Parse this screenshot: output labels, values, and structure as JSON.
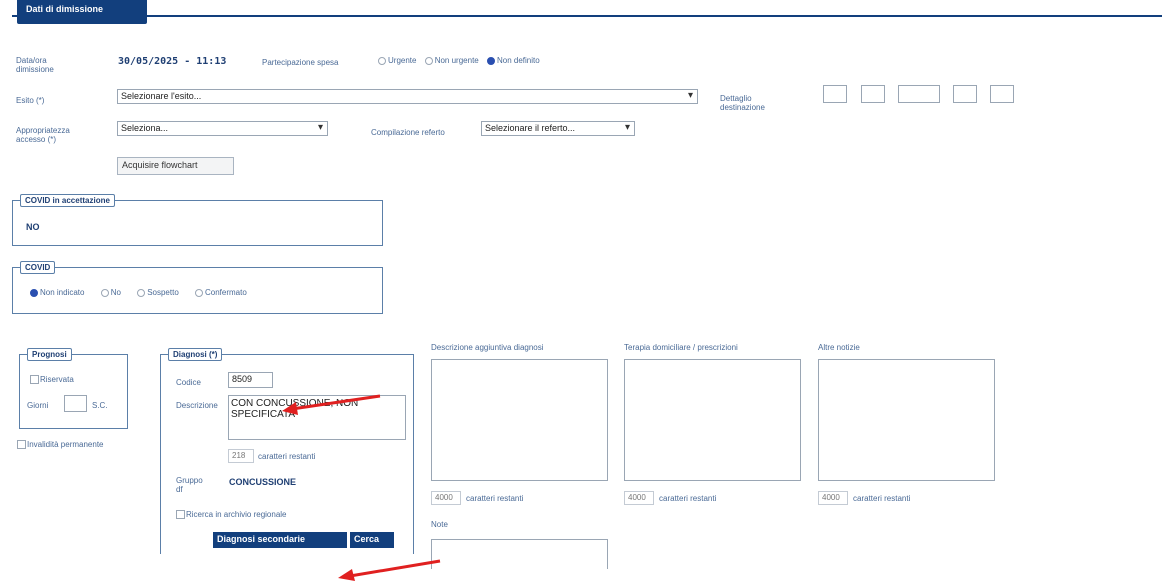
{
  "section": {
    "title": "Dati di dimissione"
  },
  "header": {
    "datetime_label": "Data/ora dimissione",
    "datetime_value": "30/05/2025 - 11:13",
    "partecipazione_label": "Partecipazione spesa",
    "options": [
      "Urgente",
      "Non urgente",
      "Non definito"
    ],
    "selected": "Non definito"
  },
  "esito": {
    "label": "Esito (*)",
    "value": "Selezionare l'esito..."
  },
  "dettaglio": {
    "label": "Dettaglio destinazione"
  },
  "appropriatezza": {
    "label": "Appropriatezza accesso (*)",
    "value": "Seleziona..."
  },
  "compilazione": {
    "label": "Compilazione referto",
    "value": "Selezionare il referto..."
  },
  "flowchart_button": "Acquisire flowchart",
  "covid_accettazione": {
    "title": "COVID in accettazione",
    "value": "NO"
  },
  "covid": {
    "title": "COVID",
    "options": [
      "Non indicato",
      "No",
      "Sospetto",
      "Confermato"
    ],
    "selected": "Non indicato"
  },
  "prognosi": {
    "title": "Prognosi",
    "riservata": "Riservata",
    "giorni": "Giorni",
    "sc": "S.C."
  },
  "invalidita": "Invalidità permanente",
  "diagnosi": {
    "title": "Diagnosi (*)",
    "codice_label": "Codice",
    "codice_value": "8509",
    "descrizione_label": "Descrizione",
    "descrizione_value": "CON CONCUSSIONE, NON SPECIFICATA",
    "remaining": "218",
    "remaining_label": "caratteri restanti",
    "gruppo_label": "Gruppo df",
    "gruppo_value": "CONCUSSIONE",
    "ricerca": "Ricerca in archivio regionale",
    "secondarie_button": "Diagnosi secondarie",
    "cerca_button": "Cerca"
  },
  "textareas": [
    {
      "label": "Descrizione aggiuntiva diagnosi",
      "remaining": "4000",
      "remaining_label": "caratteri restanti"
    },
    {
      "label": "Terapia domiciliare / prescrizioni",
      "remaining": "4000",
      "remaining_label": "caratteri restanti"
    },
    {
      "label": "Altre notizie",
      "remaining": "4000",
      "remaining_label": "caratteri restanti"
    }
  ],
  "note": {
    "label": "Note"
  },
  "colors": {
    "accent": "#123f7d",
    "arrow": "#e02020"
  }
}
